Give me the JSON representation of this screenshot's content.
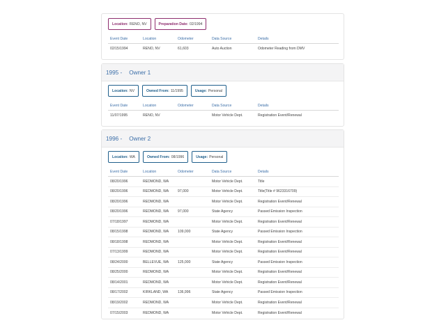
{
  "headers": [
    "Event Date",
    "Location",
    "Odometer",
    "Data Source",
    "Details"
  ],
  "card1": {
    "tags": [
      {
        "label": "Location:",
        "value": "RENO, NV"
      },
      {
        "label": "Preparation Date:",
        "value": "02/1994"
      }
    ],
    "rows": [
      [
        "02/15/1994",
        "RENO, NV",
        "61,603",
        "Auto Auction",
        "Odometer Reading from DMV"
      ]
    ]
  },
  "card2": {
    "year": "1995 -",
    "owner": "Owner 1",
    "tags": [
      {
        "label": "Location:",
        "value": "NV"
      },
      {
        "label": "Owned From:",
        "value": "11/1995"
      },
      {
        "label": "Usage:",
        "value": "Personal"
      }
    ],
    "rows": [
      [
        "11/07/1995",
        "RENO, NV",
        "",
        "Motor Vehicle Dept.",
        "Registration Event/Renewal"
      ]
    ]
  },
  "card3": {
    "year": "1996 -",
    "owner": "Owner 2",
    "tags": [
      {
        "label": "Location:",
        "value": "WA"
      },
      {
        "label": "Owned From:",
        "value": "08/1996"
      },
      {
        "label": "Usage:",
        "value": "Personal"
      }
    ],
    "rows": [
      [
        "08/20/1996",
        "REDMOND, WA",
        "",
        "Motor Vehicle Dept.",
        "Title"
      ],
      [
        "08/20/1996",
        "REDMOND, WA",
        "97,000",
        "Motor Vehicle Dept.",
        "Title(Title # 9623316709)"
      ],
      [
        "08/20/1996",
        "REDMOND, WA",
        "",
        "Motor Vehicle Dept.",
        "Registration Event/Renewal"
      ],
      [
        "08/20/1996",
        "REDMOND, WA",
        "97,000",
        "State Agency",
        "Passed Emission Inspection"
      ],
      [
        "07/18/1997",
        "REDMOND, WA",
        "",
        "Motor Vehicle Dept.",
        "Registration Event/Renewal"
      ],
      [
        "08/15/1998",
        "REDMOND, WA",
        "109,000",
        "State Agency",
        "Passed Emission Inspection"
      ],
      [
        "08/18/1998",
        "REDMOND, WA",
        "",
        "Motor Vehicle Dept.",
        "Registration Event/Renewal"
      ],
      [
        "07/13/1999",
        "REDMOND, WA",
        "",
        "Motor Vehicle Dept.",
        "Registration Event/Renewal"
      ],
      [
        "08/24/2000",
        "BELLEVUE, WA",
        "125,000",
        "State Agency",
        "Passed Emission Inspection"
      ],
      [
        "08/25/2000",
        "REDMOND, WA",
        "",
        "Motor Vehicle Dept.",
        "Registration Event/Renewal"
      ],
      [
        "08/14/2001",
        "REDMOND, WA",
        "",
        "Motor Vehicle Dept.",
        "Registration Event/Renewal"
      ],
      [
        "08/17/2002",
        "KIRKLAND, WA",
        "136,996",
        "State Agency",
        "Passed Emission Inspection"
      ],
      [
        "08/19/2002",
        "REDMOND, WA",
        "",
        "Motor Vehicle Dept.",
        "Registration Event/Renewal"
      ],
      [
        "07/15/2003",
        "REDMOND, WA",
        "",
        "Motor Vehicle Dept.",
        "Registration Event/Renewal"
      ]
    ]
  }
}
